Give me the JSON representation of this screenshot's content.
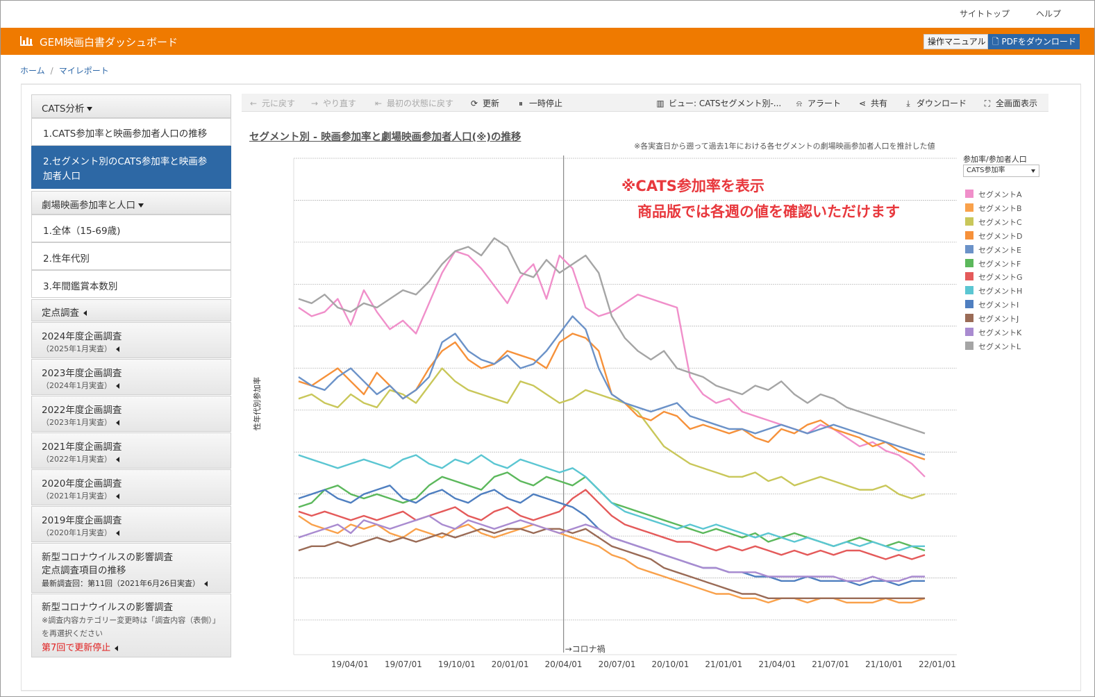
{
  "top_links": {
    "site_top": "サイトトップ",
    "help": "ヘルプ"
  },
  "header": {
    "title": "GEM映画白書ダッシュボード",
    "manual_button": "操作マニュアル",
    "pdf_button": "PDFをダウンロード",
    "accent_color": "#ef7a00"
  },
  "breadcrumb": {
    "home": "ホーム",
    "sep": "/",
    "current": "マイレポート"
  },
  "sidebar": {
    "cats_header": "CATS分析",
    "cats_items": [
      "1.CATS参加率と映画参加者人口の推移",
      "2.セグメント別のCATS参加率と映画参",
      "加者人口"
    ],
    "theater_header": "劇場映画参加率と人口",
    "theater_items": [
      "1.全体（15-69歳)",
      "2.性年代別",
      "3.年間鑑賞本数別"
    ],
    "survey_header": "定点調査",
    "surveys": [
      {
        "title": "2024年度企画調査",
        "sub": "（2025年1月実査）"
      },
      {
        "title": "2023年度企画調査",
        "sub": "（2024年1月実査）"
      },
      {
        "title": "2022年度企画調査",
        "sub": "（2023年1月実査）"
      },
      {
        "title": "2021年度企画調査",
        "sub": "（2022年1月実査）"
      },
      {
        "title": "2020年度企画調査",
        "sub": "（2021年1月実査）"
      },
      {
        "title": "2019年度企画調査",
        "sub": "（2020年1月実査）"
      }
    ],
    "covid1": {
      "line1": "新型コロナウイルスの影響調査",
      "line2": "定点調査項目の推移",
      "line3": "最新調査回：第11回（2021年6月26日実査）"
    },
    "covid2": {
      "line1": "新型コロナウイルスの影響調査",
      "line2": "※調査内容カテゴリー変更時は「調査内容（表側）」",
      "line3": "を再選択ください",
      "line4": "第7回で更新停止"
    }
  },
  "toolbar": {
    "undo": "元に戻す",
    "redo": "やり直す",
    "reset": "最初の状態に戻す",
    "refresh": "更新",
    "pause": "一時停止",
    "view": "ビュー: CATSセグメント別-...",
    "alert": "アラート",
    "share": "共有",
    "download": "ダウンロード",
    "fullscreen": "全画面表示"
  },
  "chart_title": "セグメント別 - 映画参加率と劇場映画参加者人口(※)の推移",
  "chart_note": "※各実査日から遡って過去1年における各セグメントの劇場映画参加者人口を推計した値",
  "overlay": {
    "line1": "※CATS参加率を表示",
    "line2": "商品版では各週の値を確認いただけます"
  },
  "legend_title": "参加率/参加者人口",
  "legend_select": "CATS参加率",
  "chart_data": {
    "type": "line",
    "title": "セグメント別 - 映画参加率と劇場映画参加者人口(※)の推移",
    "ylabel": "性年代別参加率",
    "x_ticks": [
      "19/04/01",
      "19/07/01",
      "19/10/01",
      "20/01/01",
      "20/04/01",
      "20/07/01",
      "20/10/01",
      "21/01/01",
      "21/04/01",
      "21/07/01",
      "21/10/01",
      "22/01/01"
    ],
    "annotation": "→コロナ禍",
    "annotation_x": "20/04/01",
    "y_gridlines": 12,
    "y_tick_labels_visible": false,
    "x_start": "19/01/07",
    "x_end": "22/01/01",
    "series": [
      {
        "name": "セグメントA",
        "color": "#f08fca",
        "values": [
          72,
          70,
          71,
          74,
          68,
          76,
          71,
          67,
          69,
          66,
          73,
          80,
          85,
          84,
          81,
          77,
          73,
          79,
          82,
          74,
          84,
          81,
          72,
          70,
          71,
          73,
          75,
          74,
          73,
          72,
          56,
          52,
          50,
          51,
          48,
          47,
          46,
          45,
          44,
          43,
          45,
          44,
          42,
          40,
          41,
          39,
          38,
          36,
          33
        ]
      },
      {
        "name": "セグメントB",
        "color": "#f9a14b",
        "values": [
          24,
          22,
          21,
          20,
          22,
          21,
          22,
          20,
          19,
          21,
          20,
          19,
          21,
          22,
          20,
          19,
          20,
          21,
          22,
          21,
          20,
          19,
          18,
          17,
          15,
          14,
          12,
          11,
          10,
          9,
          8,
          7,
          6,
          6,
          5,
          5,
          4,
          5,
          5,
          4,
          5,
          5,
          4,
          4,
          4,
          5,
          4,
          4,
          5
        ]
      },
      {
        "name": "セグメントC",
        "color": "#c9c75a",
        "values": [
          51,
          52,
          50,
          49,
          52,
          50,
          49,
          53,
          52,
          50,
          54,
          58,
          55,
          53,
          52,
          51,
          50,
          55,
          54,
          52,
          50,
          51,
          53,
          52,
          51,
          50,
          48,
          44,
          40,
          38,
          36,
          35,
          34,
          33,
          33,
          34,
          32,
          33,
          31,
          32,
          33,
          32,
          31,
          30,
          30,
          31,
          29,
          28,
          29
        ]
      },
      {
        "name": "セグメントD",
        "color": "#f6913a",
        "values": [
          55,
          54,
          56,
          58,
          55,
          52,
          57,
          54,
          51,
          53,
          58,
          62,
          64,
          60,
          58,
          59,
          62,
          61,
          60,
          58,
          64,
          66,
          65,
          62,
          52,
          50,
          47,
          46,
          48,
          47,
          44,
          45,
          44,
          43,
          44,
          42,
          41,
          44,
          43,
          45,
          46,
          44,
          43,
          42,
          40,
          41,
          39,
          38,
          37
        ]
      },
      {
        "name": "セグメントE",
        "color": "#6b92c8",
        "values": [
          56,
          54,
          53,
          56,
          58,
          55,
          52,
          54,
          51,
          53,
          56,
          64,
          66,
          62,
          60,
          59,
          61,
          58,
          59,
          62,
          66,
          70,
          67,
          58,
          52,
          50,
          49,
          48,
          49,
          50,
          47,
          46,
          45,
          44,
          44,
          43,
          44,
          45,
          44,
          43,
          44,
          45,
          44,
          43,
          42,
          41,
          40,
          39,
          38
        ]
      },
      {
        "name": "セグメントF",
        "color": "#5cb85c",
        "values": [
          26,
          27,
          30,
          31,
          29,
          28,
          29,
          28,
          27,
          28,
          31,
          33,
          32,
          31,
          30,
          33,
          34,
          32,
          31,
          33,
          32,
          31,
          33,
          30,
          27,
          26,
          25,
          24,
          23,
          22,
          21,
          20,
          21,
          20,
          19,
          20,
          18,
          19,
          20,
          19,
          18,
          17,
          18,
          19,
          18,
          17,
          18,
          17,
          16
        ]
      },
      {
        "name": "セグメントG",
        "color": "#e45a5a",
        "values": [
          25,
          24,
          25,
          24,
          23,
          24,
          23,
          24,
          25,
          23,
          24,
          25,
          26,
          24,
          23,
          25,
          26,
          24,
          23,
          24,
          25,
          28,
          30,
          27,
          24,
          22,
          21,
          20,
          19,
          18,
          18,
          17,
          16,
          17,
          16,
          17,
          16,
          15,
          16,
          15,
          16,
          15,
          16,
          16,
          15,
          14,
          15,
          14,
          15
        ]
      },
      {
        "name": "セグメントH",
        "color": "#5bc6d2",
        "values": [
          38,
          37,
          36,
          35,
          36,
          37,
          36,
          35,
          37,
          38,
          36,
          35,
          37,
          36,
          38,
          36,
          35,
          37,
          36,
          35,
          34,
          35,
          33,
          30,
          27,
          25,
          24,
          23,
          22,
          21,
          22,
          21,
          22,
          21,
          20,
          19,
          20,
          19,
          18,
          19,
          18,
          17,
          18,
          17,
          18,
          17,
          16,
          17,
          17
        ]
      },
      {
        "name": "セグメントI",
        "color": "#4f7fc0",
        "values": [
          28,
          29,
          30,
          28,
          27,
          29,
          30,
          31,
          28,
          27,
          29,
          30,
          28,
          27,
          29,
          30,
          28,
          27,
          29,
          28,
          27,
          26,
          24,
          21,
          19,
          18,
          17,
          16,
          15,
          14,
          13,
          12,
          12,
          11,
          11,
          10,
          10,
          9,
          9,
          10,
          9,
          9,
          9,
          8,
          9,
          9,
          8,
          9,
          9
        ]
      },
      {
        "name": "セグメントJ",
        "color": "#9a6b56",
        "values": [
          16,
          17,
          17,
          18,
          17,
          18,
          19,
          18,
          19,
          18,
          19,
          20,
          19,
          20,
          21,
          20,
          21,
          21,
          20,
          21,
          21,
          20,
          21,
          19,
          17,
          16,
          15,
          14,
          12,
          11,
          10,
          9,
          8,
          7,
          6,
          6,
          5,
          5,
          5,
          5,
          5,
          5,
          5,
          5,
          5,
          5,
          5,
          5,
          5
        ]
      },
      {
        "name": "セグメントK",
        "color": "#a98bd0",
        "values": [
          19,
          20,
          21,
          22,
          20,
          23,
          22,
          21,
          22,
          23,
          24,
          22,
          21,
          23,
          22,
          21,
          22,
          23,
          22,
          21,
          20,
          21,
          22,
          21,
          19,
          18,
          17,
          16,
          15,
          14,
          13,
          12,
          12,
          11,
          11,
          11,
          10,
          10,
          10,
          10,
          10,
          10,
          9,
          9,
          10,
          9,
          9,
          10,
          10
        ]
      },
      {
        "name": "セグメントL",
        "color": "#a5a5a5",
        "values": [
          74,
          73,
          75,
          72,
          71,
          73,
          72,
          74,
          76,
          75,
          78,
          82,
          85,
          86,
          84,
          88,
          86,
          80,
          79,
          83,
          80,
          82,
          84,
          80,
          70,
          65,
          62,
          60,
          62,
          58,
          57,
          56,
          54,
          53,
          52,
          54,
          53,
          55,
          52,
          50,
          52,
          51,
          49,
          48,
          47,
          46,
          45,
          44,
          43
        ]
      }
    ]
  }
}
